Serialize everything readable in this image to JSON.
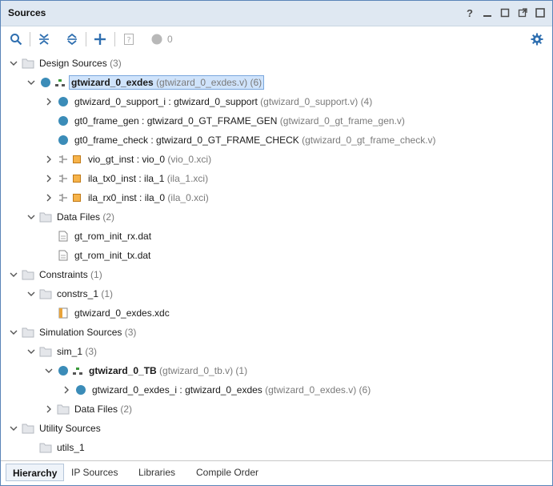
{
  "window": {
    "title": "Sources",
    "controls": {
      "help": "?",
      "minimize": "▢",
      "restore": "▢",
      "maximize": "□"
    }
  },
  "toolbar": {
    "message_count": "0"
  },
  "tree": {
    "design_sources": {
      "label": "Design Sources",
      "count": "(3)"
    },
    "top": {
      "label": "gtwizard_0_exdes",
      "file": "(gtwizard_0_exdes.v)",
      "count": "(6)"
    },
    "support": {
      "label": "gtwizard_0_support_i : gtwizard_0_support",
      "file": "(gtwizard_0_support.v)",
      "count": "(4)"
    },
    "frame_gen": {
      "label": "gt0_frame_gen : gtwizard_0_GT_FRAME_GEN",
      "file": "(gtwizard_0_gt_frame_gen.v)"
    },
    "frame_check": {
      "label": "gt0_frame_check : gtwizard_0_GT_FRAME_CHECK",
      "file": "(gtwizard_0_gt_frame_check.v)"
    },
    "vio": {
      "label": "vio_gt_inst : vio_0",
      "file": "(vio_0.xci)"
    },
    "ila_tx": {
      "label": "ila_tx0_inst : ila_1",
      "file": "(ila_1.xci)"
    },
    "ila_rx": {
      "label": "ila_rx0_inst : ila_0",
      "file": "(ila_0.xci)"
    },
    "data_files": {
      "label": "Data Files",
      "count": "(2)"
    },
    "rom_rx": {
      "label": "gt_rom_init_rx.dat"
    },
    "rom_tx": {
      "label": "gt_rom_init_tx.dat"
    },
    "constraints": {
      "label": "Constraints",
      "count": "(1)"
    },
    "constrs_1": {
      "label": "constrs_1",
      "count": "(1)"
    },
    "xdc": {
      "label": "gtwizard_0_exdes.xdc"
    },
    "sim_sources": {
      "label": "Simulation Sources",
      "count": "(3)"
    },
    "sim_1": {
      "label": "sim_1",
      "count": "(3)"
    },
    "tb": {
      "label": "gtwizard_0_TB",
      "file": "(gtwizard_0_tb.v)",
      "count": "(1)"
    },
    "exdes_i": {
      "label": "gtwizard_0_exdes_i : gtwizard_0_exdes",
      "file": "(gtwizard_0_exdes.v)",
      "count": "(6)"
    },
    "sim_data_files": {
      "label": "Data Files",
      "count": "(2)"
    },
    "utility_sources": {
      "label": "Utility Sources"
    },
    "utils_1": {
      "label": "utils_1"
    }
  },
  "tabs": [
    {
      "label": "Hierarchy"
    },
    {
      "label": "IP Sources"
    },
    {
      "label": "Libraries"
    },
    {
      "label": "Compile Order"
    }
  ],
  "colors": {
    "accent": "#2f6fb0",
    "ip_square": "#f0a030",
    "folder": "#c7cbd1",
    "selected_bg": "#cfe3fb"
  }
}
